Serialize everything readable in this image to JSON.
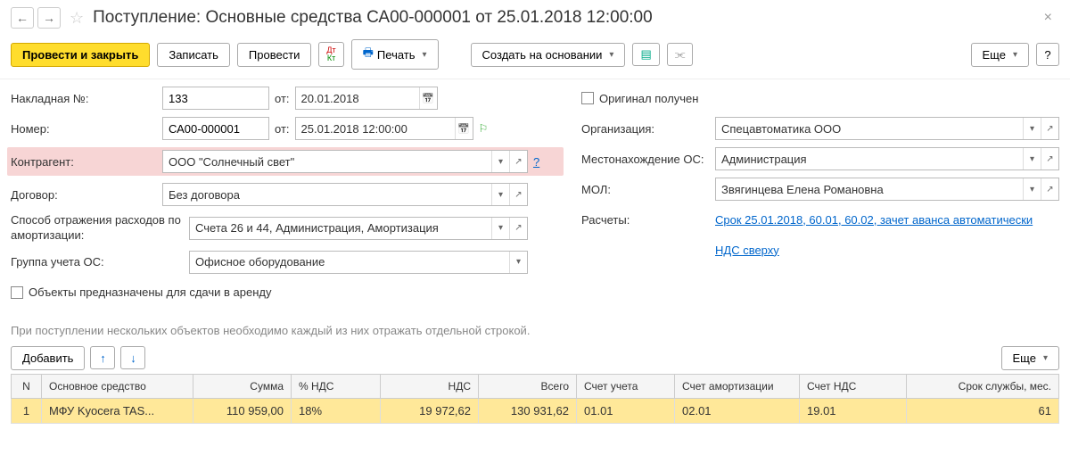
{
  "title": "Поступление: Основные средства СА00-000001 от 25.01.2018 12:00:00",
  "toolbar": {
    "post_close": "Провести и закрыть",
    "write": "Записать",
    "post": "Провести",
    "print": "Печать",
    "create_based": "Создать на основании",
    "more": "Еще",
    "help": "?"
  },
  "form": {
    "invoice_label": "Накладная №:",
    "invoice_no": "133",
    "from_label": "от:",
    "invoice_date": "20.01.2018",
    "number_label": "Номер:",
    "number": "СА00-000001",
    "number_date": "25.01.2018 12:00:00",
    "counterparty_label": "Контрагент:",
    "counterparty": "ООО \"Солнечный свет\"",
    "contract_label": "Договор:",
    "contract": "Без договора",
    "depr_method_label": "Способ отражения расходов по амортизации:",
    "depr_method": "Счета 26 и 44, Администрация, Амортизация",
    "asset_group_label": "Группа учета ОС:",
    "asset_group": "Офисное оборудование",
    "rent_checkbox_label": "Объекты предназначены для сдачи в аренду",
    "original_label": "Оригинал получен",
    "org_label": "Организация:",
    "org": "Спецавтоматика ООО",
    "location_label": "Местонахождение ОС:",
    "location": "Администрация",
    "mol_label": "МОЛ:",
    "mol": "Звягинцева Елена Романовна",
    "calc_label": "Расчеты:",
    "calc_link": "Срок 25.01.2018, 60.01, 60.02, зачет аванса автоматически",
    "vat_link": "НДС сверху"
  },
  "note": "При поступлении нескольких объектов необходимо каждый из них отражать отдельной строкой.",
  "table_toolbar": {
    "add": "Добавить",
    "more": "Еще"
  },
  "table": {
    "headers": {
      "n": "N",
      "asset": "Основное средство",
      "sum": "Сумма",
      "vat_pct": "% НДС",
      "vat": "НДС",
      "total": "Всего",
      "acct": "Счет учета",
      "depr_acct": "Счет амортизации",
      "vat_acct": "Счет НДС",
      "life": "Срок службы, мес."
    },
    "rows": [
      {
        "n": "1",
        "asset": "МФУ Kyocera TAS...",
        "sum": "110 959,00",
        "vat_pct": "18%",
        "vat": "19 972,62",
        "total": "130 931,62",
        "acct": "01.01",
        "depr_acct": "02.01",
        "vat_acct": "19.01",
        "life": "61"
      }
    ]
  }
}
